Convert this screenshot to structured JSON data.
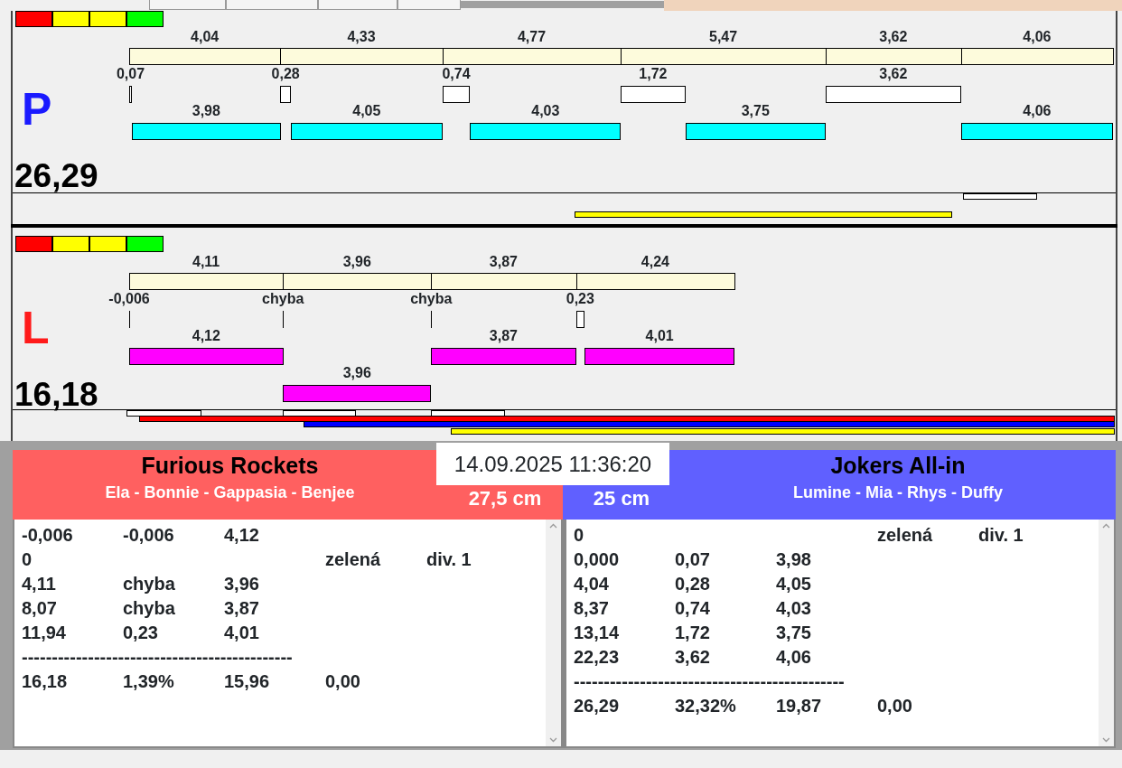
{
  "tracks": [
    {
      "letter": {
        "text": "P",
        "color": "#1a1aff"
      },
      "color": "#00ffff",
      "total": "26,29",
      "segments": [
        {
          "time": "4,04",
          "reaction": "0,07",
          "run": "3,98",
          "kind": "upper"
        },
        {
          "time": "4,33",
          "reaction": "0,28",
          "run": "4,05",
          "kind": "upper"
        },
        {
          "time": "4,77",
          "reaction": "0,74",
          "run": "4,03",
          "kind": "upper"
        },
        {
          "time": "5,47",
          "reaction": "1,72",
          "run": "3,75",
          "kind": "upper"
        },
        {
          "time": "3,62",
          "reaction": "3,62"
        },
        {
          "time": "4,06",
          "run": "4,06",
          "kind": "upper"
        }
      ]
    },
    {
      "letter": {
        "text": "L",
        "color": "#ff1a1a"
      },
      "color": "#ff00ff",
      "total": "16,18",
      "segments": [
        {
          "time": "4,11",
          "reaction": "-0,006",
          "run": "4,12",
          "kind": "upper"
        },
        {
          "time": "3,96",
          "reaction": "chyba",
          "run": "3,96",
          "kind": "lower"
        },
        {
          "time": "3,87",
          "reaction": "chyba",
          "run": "3,87",
          "kind": "upper"
        },
        {
          "time": "4,24",
          "reaction": "0,23",
          "run": "4,01",
          "kind": "upper"
        }
      ]
    }
  ],
  "datetime": "14.09.2025 11:36:20",
  "teams": [
    {
      "name": "Furious Rockets",
      "members": "Ela - Bonnie - Gappasia - Benjee",
      "distance": "27,5 cm",
      "color": "#ff6060",
      "rows": [
        {
          "kind": "data",
          "cells": [
            "-0,006",
            "-0,006",
            "4,12"
          ]
        },
        {
          "kind": "data",
          "cells": [
            "0",
            null,
            null,
            "zelená",
            "div. 1"
          ]
        },
        {
          "kind": "data",
          "cells": [
            "4,11",
            "chyba",
            "3,96"
          ]
        },
        {
          "kind": "data",
          "cells": [
            "8,07",
            "chyba",
            "3,87"
          ]
        },
        {
          "kind": "data",
          "cells": [
            "11,94",
            "0,23",
            "4,01"
          ]
        },
        {
          "kind": "rule",
          "text": "---------------------------------------------"
        },
        {
          "kind": "data",
          "cells": [
            "16,18",
            "1,39%",
            "15,96",
            "0,00"
          ]
        }
      ]
    },
    {
      "name": "Jokers All-in",
      "members": "Lumine - Mia - Rhys - Duffy",
      "distance": "25 cm",
      "color": "#6060ff",
      "rows": [
        {
          "kind": "data",
          "cells": [
            "0",
            null,
            null,
            "zelená",
            "div. 1"
          ]
        },
        {
          "kind": "data",
          "cells": [
            "0,000",
            "0,07",
            "3,98"
          ]
        },
        {
          "kind": "data",
          "cells": [
            "4,04",
            "0,28",
            "4,05"
          ]
        },
        {
          "kind": "data",
          "cells": [
            "8,37",
            "0,74",
            "4,03"
          ]
        },
        {
          "kind": "data",
          "cells": [
            "13,14",
            "1,72",
            "3,75"
          ]
        },
        {
          "kind": "data",
          "cells": [
            "22,23",
            "3,62",
            "4,06"
          ]
        },
        {
          "kind": "rule",
          "text": "---------------------------------------------"
        },
        {
          "kind": "data",
          "cells": [
            "26,29",
            "32,32%",
            "19,87",
            "0,00"
          ]
        }
      ]
    }
  ]
}
